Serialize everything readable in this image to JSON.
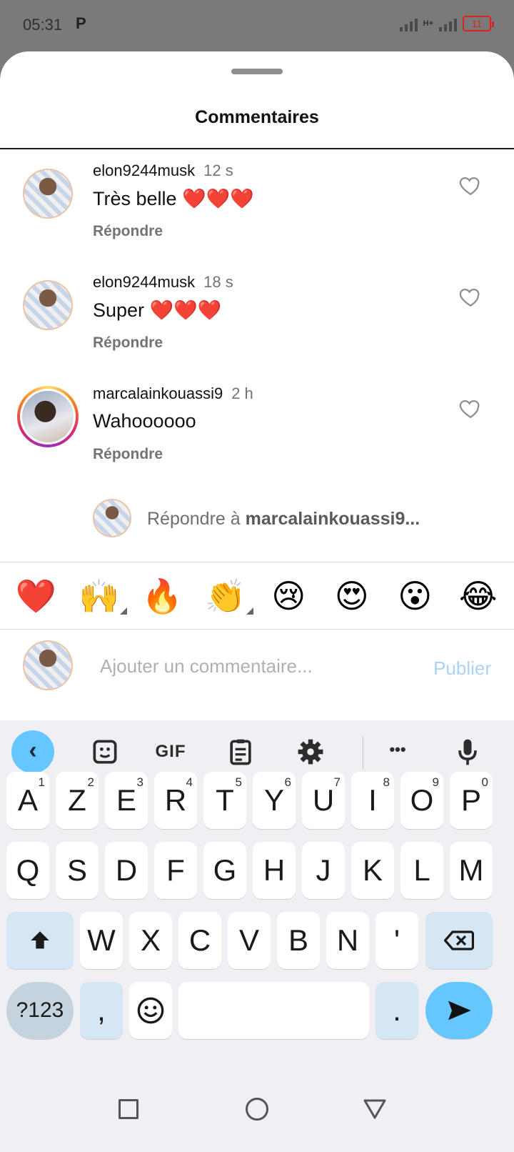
{
  "status_bar": {
    "time": "05:31",
    "carrier_icon": "P",
    "network": "H+",
    "battery": "11"
  },
  "sheet": {
    "title": "Commentaires"
  },
  "comments": [
    {
      "username": "elon9244musk",
      "time": "12 s",
      "text": "Très belle ❤️❤️❤️",
      "reply_label": "Répondre"
    },
    {
      "username": "elon9244musk",
      "time": "18 s",
      "text": "Super ❤️❤️❤️",
      "reply_label": "Répondre"
    },
    {
      "username": "marcalainkouassi9",
      "time": "2 h",
      "text": "Wahoooooo",
      "reply_label": "Répondre"
    }
  ],
  "reply_to": {
    "prefix": "Répondre à ",
    "username": "marcalainkouassi9..."
  },
  "emoji_bar": [
    "❤️",
    "🙌",
    "🔥",
    "👏",
    "😢",
    "😍",
    "😮",
    "😂"
  ],
  "input": {
    "placeholder": "Ajouter un commentaire...",
    "value": "",
    "publish_label": "Publier"
  },
  "keyboard": {
    "toolbar": {
      "back": "‹",
      "sticker_icon": "sticker-icon",
      "gif": "GIF",
      "clipboard_icon": "clipboard-icon",
      "settings_icon": "gear-icon",
      "more": "•••",
      "mic_icon": "mic-icon"
    },
    "row1": [
      {
        "k": "A",
        "s": "1"
      },
      {
        "k": "Z",
        "s": "2"
      },
      {
        "k": "E",
        "s": "3"
      },
      {
        "k": "R",
        "s": "4"
      },
      {
        "k": "T",
        "s": "5"
      },
      {
        "k": "Y",
        "s": "6"
      },
      {
        "k": "U",
        "s": "7"
      },
      {
        "k": "I",
        "s": "8"
      },
      {
        "k": "O",
        "s": "9"
      },
      {
        "k": "P",
        "s": "0"
      }
    ],
    "row2": [
      "Q",
      "S",
      "D",
      "F",
      "G",
      "H",
      "J",
      "K",
      "L",
      "M"
    ],
    "row3": [
      "W",
      "X",
      "C",
      "V",
      "B",
      "N",
      "'"
    ],
    "symbols": "?123",
    "comma": ",",
    "period": "."
  },
  "colors": {
    "accent": "#66c6ff",
    "publish": "#a9d4f5",
    "heart": "#ed1c24"
  }
}
